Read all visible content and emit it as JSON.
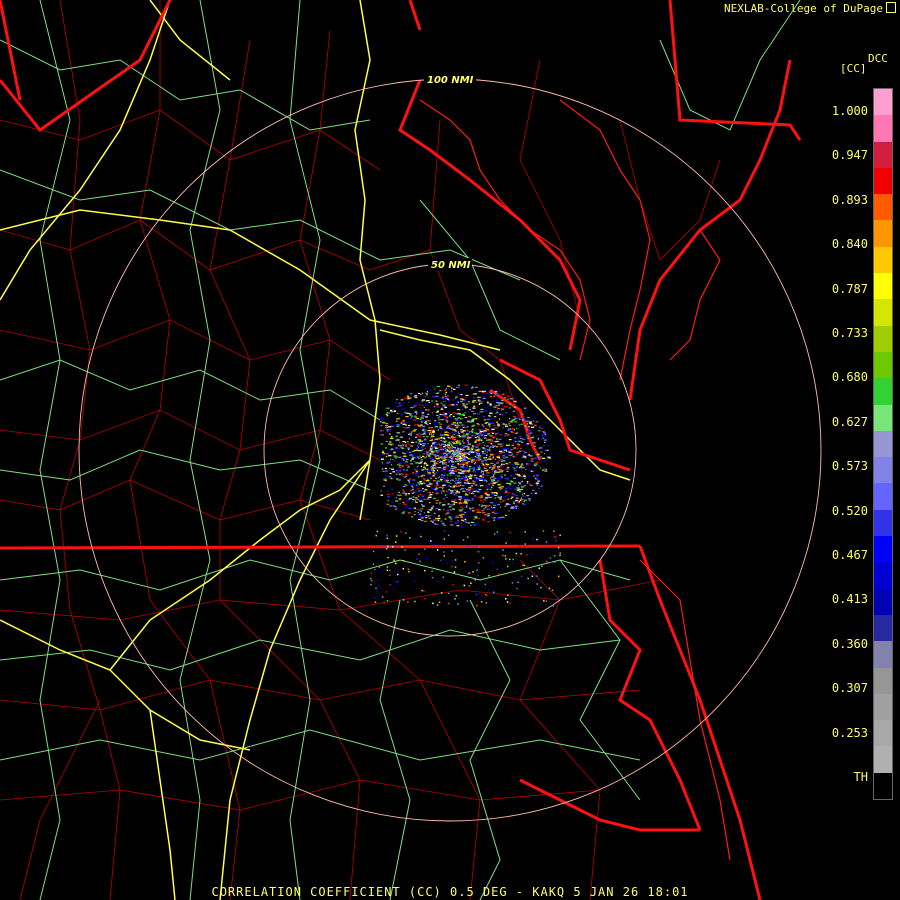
{
  "header": {
    "credit": "NEXLAB-College of DuPage"
  },
  "legend": {
    "product": "DCC",
    "unit": "[CC]",
    "ticks": [
      "1.000",
      "0.947",
      "0.893",
      "0.840",
      "0.787",
      "0.733",
      "0.680",
      "0.627",
      "0.573",
      "0.520",
      "0.467",
      "0.413",
      "0.360",
      "0.307",
      "0.253",
      "TH"
    ],
    "colors": [
      "#ff9fd0",
      "#ff78b4",
      "#d21e3c",
      "#f00000",
      "#ff5a00",
      "#ff9600",
      "#ffc800",
      "#ffff00",
      "#d2e600",
      "#a0cd00",
      "#6ec800",
      "#32d232",
      "#78e678",
      "#9696d2",
      "#8282e6",
      "#6464ff",
      "#3232e6",
      "#0000ff",
      "#0000d2",
      "#0000b4",
      "#2828a0",
      "#8282aa",
      "#969696",
      "#a0a0a0",
      "#a8a8a8",
      "#b0b0b0",
      "#000000"
    ]
  },
  "map": {
    "rings": [
      {
        "label": "50 NMI"
      },
      {
        "label": "100 NMI"
      }
    ],
    "colors": {
      "state": "#ff0000",
      "county": "#cc0000",
      "highway_primary": "#ffff55",
      "highway_secondary": "#88ff88",
      "ring": "#ffbbaa"
    }
  },
  "footer": {
    "caption": "CORRELATION COEFFICIENT (CC) 0.5 DEG - KAKQ 5 JAN 26 18:01"
  }
}
